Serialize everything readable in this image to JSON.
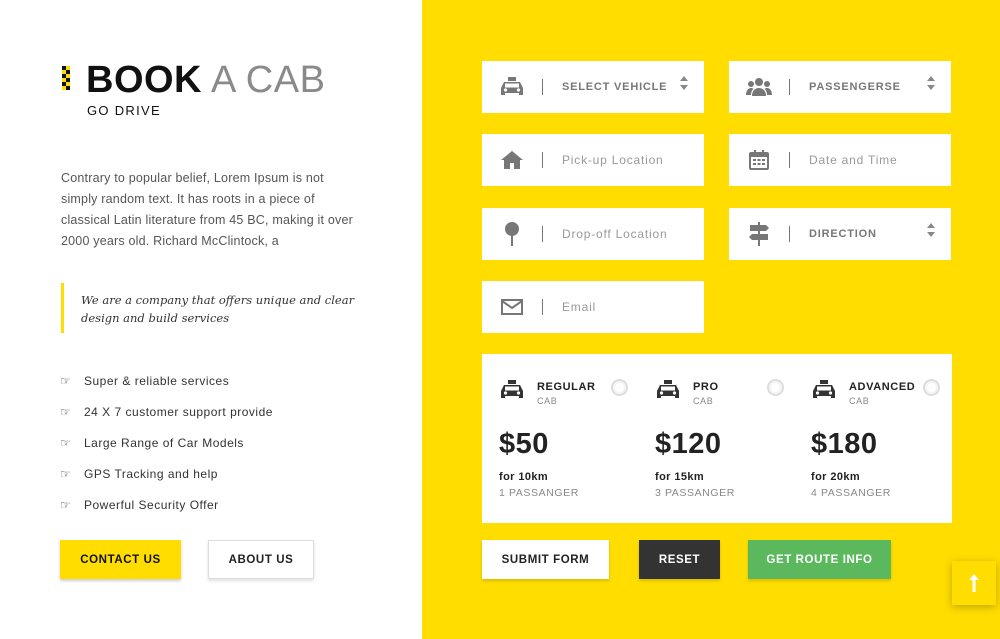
{
  "brand": {
    "title_bold": "BOOK",
    "title_light": "A CAB",
    "subtitle": "GO DRIVE"
  },
  "intro": {
    "paragraph": "Contrary to popular belief, Lorem Ipsum is not simply random text. It has roots in a piece of classical Latin literature from 45 BC, making it over 2000 years old. Richard McClintock, a",
    "quote": "We are a company that offers unique and clear design and build services"
  },
  "features": [
    "Super & reliable services",
    "24 X 7 customer support provide",
    "Large Range of Car Models",
    "GPS Tracking and help",
    "Powerful Security Offer"
  ],
  "buttons": {
    "contact": "CONTACT US",
    "about": "ABOUT US",
    "submit": "SUBMIT FORM",
    "reset": "RESET",
    "route": "GET ROUTE INFO"
  },
  "form": {
    "vehicle": "SELECT VEHICLE",
    "passengers": "PASSENGERSE",
    "pickup": "Pick-up Location",
    "datetime": "Date and Time",
    "dropoff": "Drop-off Location",
    "direction": "DIRECTION",
    "email": "Email"
  },
  "cabs": [
    {
      "name": "REGULAR",
      "type": "CAB",
      "price": "$50",
      "distance": "for 10km",
      "passengers": "1 PASSANGER"
    },
    {
      "name": "PRO",
      "type": "CAB",
      "price": "$120",
      "distance": "for 15km",
      "passengers": "3 PASSANGER"
    },
    {
      "name": "ADVANCED",
      "type": "CAB",
      "price": "$180",
      "distance": "for 20km",
      "passengers": "4 PASSANGER"
    }
  ],
  "icons": {
    "feature": "hand-point-right-icon",
    "vehicle": "taxi-icon",
    "passengers": "users-icon",
    "pickup": "home-icon",
    "datetime": "calendar-icon",
    "dropoff": "map-pin-icon",
    "direction": "signpost-icon",
    "email": "envelope-icon",
    "scroll_top": "arrow-up-icon"
  },
  "colors": {
    "accent": "#ffdd00",
    "dark": "#333333",
    "success": "#5cb85c"
  }
}
